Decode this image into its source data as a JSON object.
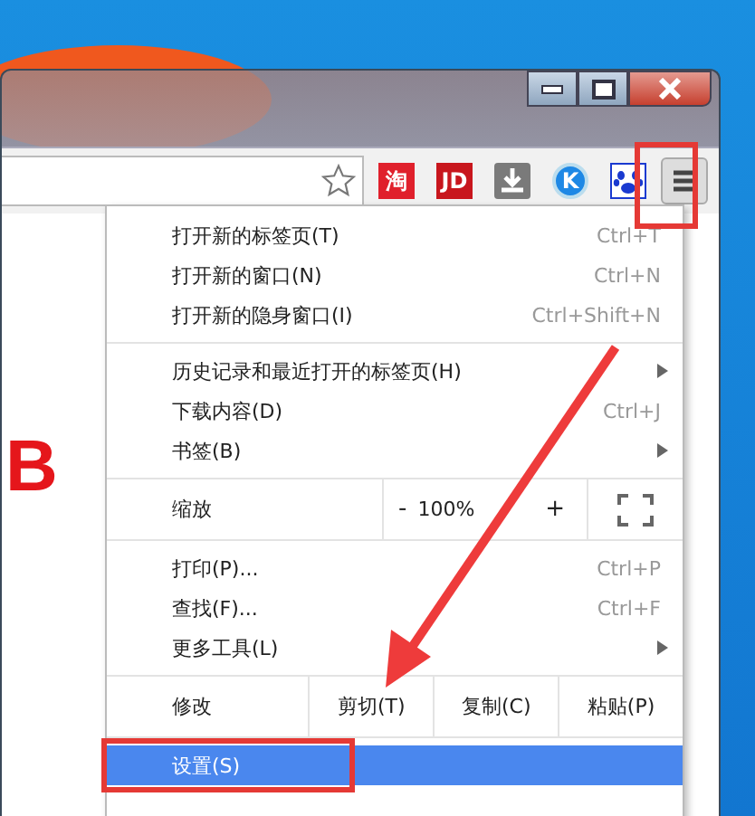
{
  "toolbar": {
    "extensions": [
      {
        "kind": "label",
        "label": "淘",
        "color": "#e0202c"
      },
      {
        "kind": "label",
        "label": "JD",
        "color": "#c8161d"
      },
      {
        "kind": "download",
        "color": "#7a7a7a"
      },
      {
        "kind": "round",
        "label": "K",
        "color": "#1e88e5"
      },
      {
        "kind": "paw",
        "color": "#1a3ad0"
      }
    ]
  },
  "page": {
    "heading": "B"
  },
  "menu": {
    "sections": [
      {
        "items": [
          {
            "kind": "item",
            "label": "打开新的标签页(T)",
            "shortcut": "Ctrl+T",
            "submenu": false,
            "selected": false
          },
          {
            "kind": "item",
            "label": "打开新的窗口(N)",
            "shortcut": "Ctrl+N",
            "submenu": false,
            "selected": false
          },
          {
            "kind": "item",
            "label": "打开新的隐身窗口(I)",
            "shortcut": "Ctrl+Shift+N",
            "submenu": false,
            "selected": false
          }
        ]
      },
      {
        "items": [
          {
            "kind": "item",
            "label": "历史记录和最近打开的标签页(H)",
            "submenu": true,
            "selected": false
          },
          {
            "kind": "item",
            "label": "下载内容(D)",
            "shortcut": "Ctrl+J",
            "submenu": false,
            "selected": false
          },
          {
            "kind": "item",
            "label": "书签(B)",
            "submenu": true,
            "selected": false
          }
        ]
      },
      {
        "items": [
          {
            "kind": "zoom",
            "label": "缩放",
            "minus": "-",
            "value": "100%",
            "plus": "+"
          }
        ]
      },
      {
        "items": [
          {
            "kind": "item",
            "label": "打印(P)...",
            "shortcut": "Ctrl+P",
            "submenu": false,
            "selected": false
          },
          {
            "kind": "item",
            "label": "查找(F)...",
            "shortcut": "Ctrl+F",
            "submenu": false,
            "selected": false
          },
          {
            "kind": "item",
            "label": "更多工具(L)",
            "submenu": true,
            "selected": false
          }
        ]
      },
      {
        "items": [
          {
            "kind": "edit",
            "label": "修改",
            "buttons": [
              "剪切(T)",
              "复制(C)",
              "粘贴(P)"
            ]
          }
        ]
      },
      {
        "items": [
          {
            "kind": "item",
            "label": "设置(S)",
            "submenu": false,
            "selected": true
          }
        ]
      }
    ]
  }
}
